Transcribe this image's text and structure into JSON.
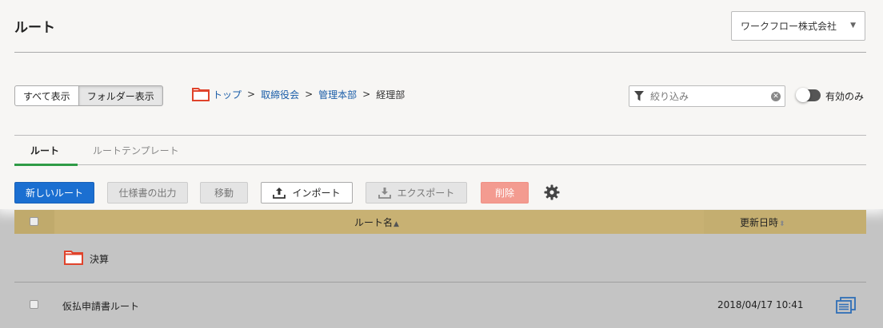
{
  "header": {
    "title": "ルート",
    "company": "ワークフロー株式会社"
  },
  "view_toggle": {
    "all": "すべて表示",
    "folder": "フォルダー表示"
  },
  "breadcrumb": {
    "top": "トップ",
    "level1": "取締役会",
    "level2": "管理本部",
    "current": "経理部",
    "separator": ">"
  },
  "filter": {
    "placeholder": "絞り込み",
    "active_only_label": "有効のみ"
  },
  "tabs": [
    {
      "label": "ルート"
    },
    {
      "label": "ルートテンプレート"
    }
  ],
  "toolbar": {
    "new_route": "新しいルート",
    "spec_output": "仕様書の出力",
    "move": "移動",
    "import": "インポート",
    "export": "エクスポート",
    "delete": "削除"
  },
  "table": {
    "col_name": "ルート名",
    "col_updated": "更新日時",
    "rows": [
      {
        "type": "folder",
        "name": "決算",
        "updated": ""
      },
      {
        "type": "route",
        "name": "仮払申請書ルート",
        "updated": "2018/04/17 10:41"
      }
    ]
  },
  "colors": {
    "primary": "#1b6fd1",
    "danger": "#f39b90",
    "folder": "#e0432b",
    "header": "#c8b173",
    "tab_active": "#2e9b46"
  }
}
